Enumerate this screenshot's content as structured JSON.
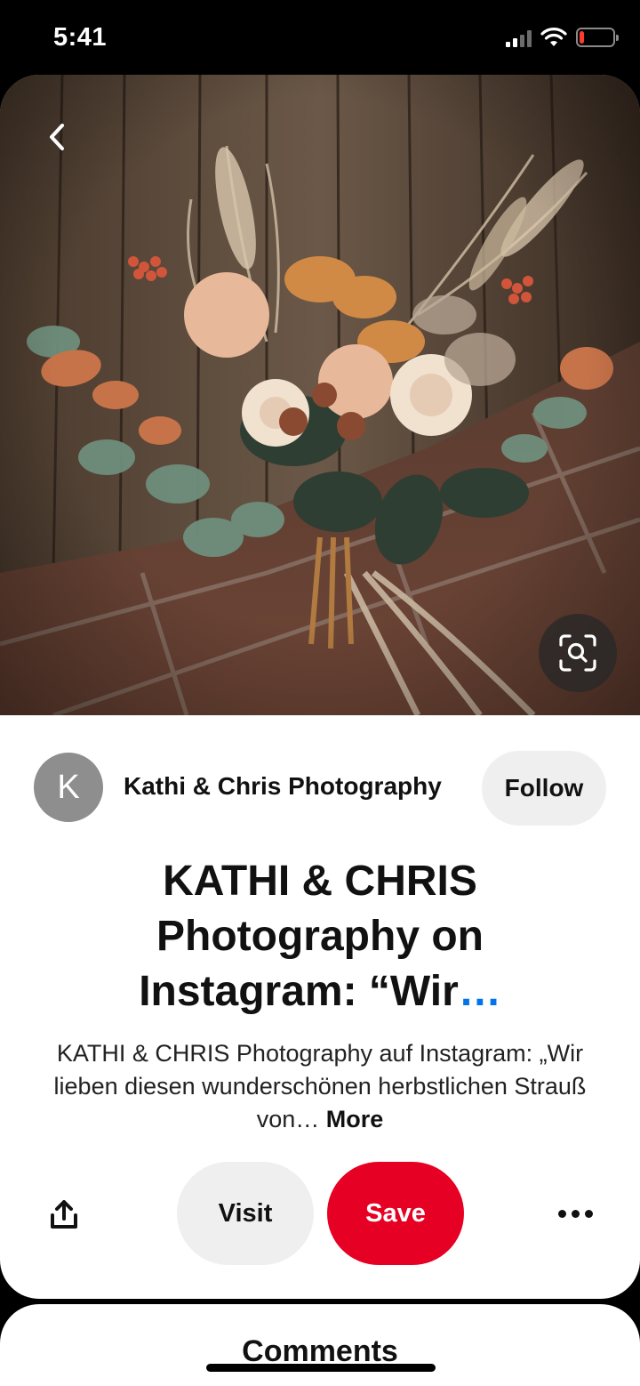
{
  "status_bar": {
    "time": "5:41",
    "battery_level": 0.15,
    "battery_color": "#ff3b30"
  },
  "pin": {
    "image_icon": "flower-bouquet-photo",
    "back_icon": "chevron-left-icon",
    "lens_icon": "visual-search-icon",
    "creator": {
      "avatar_initial": "K",
      "name": "Kathi & Chris Photography",
      "follow_label": "Follow"
    },
    "title": "KATHI & CHRIS Photography on Instagram: “Wir",
    "title_ellipsis": "…",
    "description": "KATHI & CHRIS Photography auf Instagram: „Wir lieben diesen wunderschönen herbstlichen Strauß von…",
    "description_more": "More",
    "actions": {
      "share_icon": "share-icon",
      "visit_label": "Visit",
      "save_label": "Save",
      "more_icon": "more-dots-icon"
    }
  },
  "comments": {
    "title": "Comments"
  },
  "colors": {
    "save_red": "#e60023",
    "link_blue": "#0074e8",
    "button_gray": "#efefef"
  }
}
